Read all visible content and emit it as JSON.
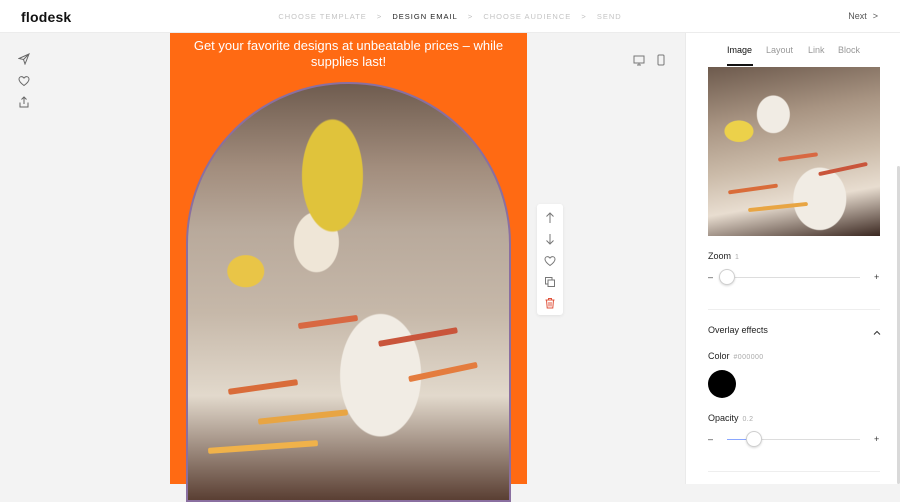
{
  "app": {
    "logo": "flodesk"
  },
  "steps": [
    {
      "label": "CHOOSE TEMPLATE",
      "state": "done"
    },
    {
      "label": "DESIGN EMAIL",
      "state": "active"
    },
    {
      "label": "CHOOSE AUDIENCE",
      "state": "todo"
    },
    {
      "label": "SEND",
      "state": "todo"
    }
  ],
  "step_separator": ">",
  "header": {
    "next_label": "Next",
    "next_chevron": ">"
  },
  "left_tools": [
    "send-icon",
    "heart-icon",
    "share-icon"
  ],
  "canvas": {
    "headline": "Get your favorite designs at unbeatable prices – while supplies last!",
    "background_color": "#ff6a13"
  },
  "device_toggles": [
    "desktop-icon",
    "mobile-icon"
  ],
  "block_tools": [
    "arrow-up-icon",
    "arrow-down-icon",
    "heart-icon",
    "duplicate-icon",
    "trash-icon"
  ],
  "panel": {
    "tabs": [
      {
        "label": "Image",
        "active": true
      },
      {
        "label": "Layout",
        "active": false
      },
      {
        "label": "Link",
        "active": false
      },
      {
        "label": "Block",
        "active": false
      }
    ],
    "zoom": {
      "label": "Zoom",
      "value": "1",
      "minus": "–",
      "plus": "+",
      "position": 0
    },
    "overlay": {
      "title": "Overlay effects",
      "color_label": "Color",
      "color_value": "#000000",
      "opacity_label": "Opacity",
      "opacity_value": "0.2",
      "opacity_level": 0.2,
      "minus": "–",
      "plus": "+"
    }
  }
}
